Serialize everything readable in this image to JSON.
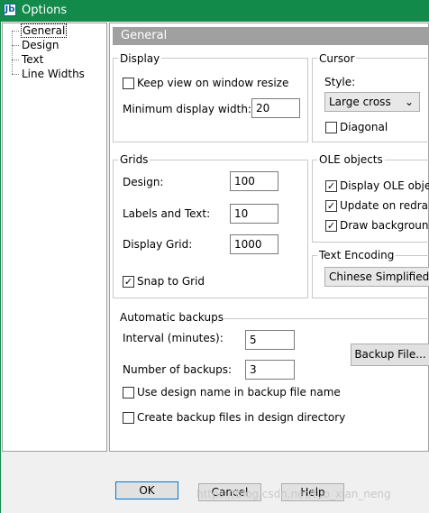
{
  "window": {
    "title": "Options"
  },
  "tree": {
    "items": [
      "General",
      "Design",
      "Text",
      "Line Widths"
    ]
  },
  "panel": {
    "header": "General"
  },
  "display": {
    "group_label": "Display",
    "keep_view_label": "Keep view on window resize",
    "keep_view_checked": false,
    "min_width_label": "Minimum display width:",
    "min_width_value": "20"
  },
  "cursor": {
    "group_label": "Cursor",
    "style_label": "Style:",
    "style_value": "Large cross",
    "diagonal_label": "Diagonal",
    "diagonal_checked": false
  },
  "grids": {
    "group_label": "Grids",
    "design_label": "Design:",
    "design_value": "100",
    "labels_text_label": "Labels and Text:",
    "labels_text_value": "10",
    "display_grid_label": "Display Grid:",
    "display_grid_value": "1000",
    "snap_label": "Snap to Grid",
    "snap_checked": true
  },
  "ole": {
    "group_label": "OLE objects",
    "display_label": "Display OLE obje",
    "update_label": "Update on redra",
    "draw_bg_label": "Draw backgroun",
    "display_checked": true,
    "update_checked": true,
    "draw_bg_checked": true
  },
  "encoding": {
    "group_label": "Text Encoding",
    "value": "Chinese Simplified"
  },
  "backups": {
    "group_label": "Automatic backups",
    "interval_label": "Interval (minutes):",
    "interval_value": "5",
    "count_label": "Number of backups:",
    "count_value": "3",
    "backup_file_button": "Backup File...",
    "use_design_name_label": "Use design name in backup file name",
    "create_in_dir_label": "Create backup files in design directory"
  },
  "buttons": {
    "ok": "OK",
    "cancel": "Cancel",
    "help": "Help"
  },
  "watermark": "https://blog.csdn.net/tuo_xian_neng",
  "colors": {
    "titlebar": "#118a4a",
    "panel_header": "#a0a0a0"
  }
}
